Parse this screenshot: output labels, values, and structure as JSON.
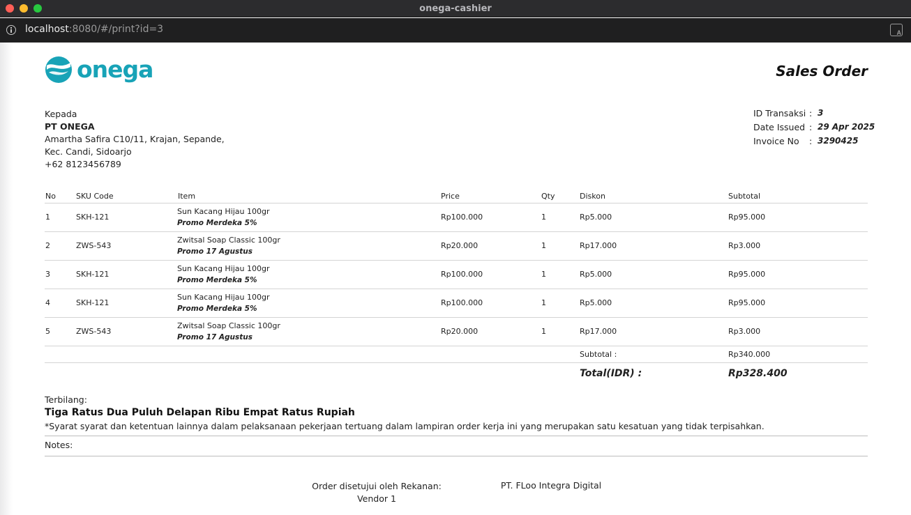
{
  "window": {
    "title": "onega-cashier"
  },
  "browser": {
    "url_host": "localhost",
    "url_rest": ":8080/#/print?id=3",
    "icons": [
      "info-icon",
      "translate-icon"
    ]
  },
  "brand": {
    "logo_text": "onega",
    "color": "#18a3b7"
  },
  "document": {
    "title": "Sales Order"
  },
  "recipient": {
    "label": "Kepada",
    "company": "PT ONEGA",
    "address_line1": "Amartha Safira C10/11, Krajan, Sepande,",
    "address_line2": "Kec. Candi, Sidoarjo",
    "phone": "+62 8123456789"
  },
  "meta": [
    {
      "label": "ID Transaksi",
      "colon": ":",
      "value": "3"
    },
    {
      "label": "Date Issued",
      "colon": ":",
      "value": "29 Apr 2025"
    },
    {
      "label": "Invoice No",
      "colon": ":",
      "value": "3290425"
    }
  ],
  "table": {
    "headers": {
      "no": "No",
      "sku": "SKU Code",
      "item": "Item",
      "price": "Price",
      "qty": "Qty",
      "discount": "Diskon",
      "subtotal": "Subtotal"
    },
    "rows": [
      {
        "no": "1",
        "sku": "SKH-121",
        "item": "Sun Kacang Hijau 100gr",
        "promo": "Promo Merdeka 5%",
        "price": "Rp100.000",
        "qty": "1",
        "discount": "Rp5.000",
        "subtotal": "Rp95.000"
      },
      {
        "no": "2",
        "sku": "ZWS-543",
        "item": "Zwitsal Soap Classic 100gr",
        "promo": "Promo 17 Agustus",
        "price": "Rp20.000",
        "qty": "1",
        "discount": "Rp17.000",
        "subtotal": "Rp3.000"
      },
      {
        "no": "3",
        "sku": "SKH-121",
        "item": "Sun Kacang Hijau 100gr",
        "promo": "Promo Merdeka 5%",
        "price": "Rp100.000",
        "qty": "1",
        "discount": "Rp5.000",
        "subtotal": "Rp95.000"
      },
      {
        "no": "4",
        "sku": "SKH-121",
        "item": "Sun Kacang Hijau 100gr",
        "promo": "Promo Merdeka 5%",
        "price": "Rp100.000",
        "qty": "1",
        "discount": "Rp5.000",
        "subtotal": "Rp95.000"
      },
      {
        "no": "5",
        "sku": "ZWS-543",
        "item": "Zwitsal Soap Classic 100gr",
        "promo": "Promo 17 Agustus",
        "price": "Rp20.000",
        "qty": "1",
        "discount": "Rp17.000",
        "subtotal": "Rp3.000"
      }
    ],
    "subtotal_label": "Subtotal :",
    "subtotal_value": "Rp340.000",
    "total_label": "Total(IDR) :",
    "total_value": "Rp328.400"
  },
  "terbilang": {
    "label": "Terbilang:",
    "value": "Tiga Ratus Dua Puluh Delapan Ribu Empat Ratus Rupiah"
  },
  "terms": "*Syarat syarat dan ketentuan lainnya dalam pelaksanaan pekerjaan tertuang dalam lampiran order kerja ini yang merupakan satu kesatuan yang tidak terpisahkan.",
  "notes_label": "Notes:",
  "signatures": {
    "left_title": "Order disetujui oleh Rekanan:",
    "left_name": "Vendor 1",
    "right_title": "PT. FLoo Integra Digital"
  }
}
